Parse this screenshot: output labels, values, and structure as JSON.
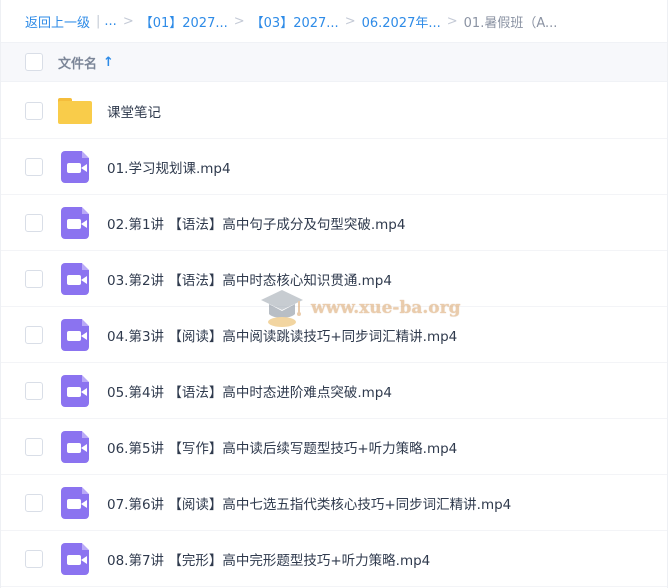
{
  "breadcrumb": {
    "back": "返回上一级",
    "separator": "|",
    "ellipsis": "...",
    "arrow": ">",
    "items": [
      "【01】2027...",
      "【03】2027...",
      "06.2027年..."
    ],
    "current": "01.暑假班（A..."
  },
  "header": {
    "column_name": "文件名",
    "sort_icon": "↑"
  },
  "files": [
    {
      "name": "课堂笔记",
      "icon": "folder-icon"
    },
    {
      "name": "01.学习规划课.mp4",
      "icon": "video-icon"
    },
    {
      "name": "02.第1讲 【语法】高中句子成分及句型突破.mp4",
      "icon": "video-icon"
    },
    {
      "name": "03.第2讲 【语法】高中时态核心知识贯通.mp4",
      "icon": "video-icon"
    },
    {
      "name": "04.第3讲 【阅读】高中阅读跳读技巧+同步词汇精讲.mp4",
      "icon": "video-icon"
    },
    {
      "name": "05.第4讲 【语法】高中时态进阶难点突破.mp4",
      "icon": "video-icon"
    },
    {
      "name": "06.第5讲 【写作】高中读后续写题型技巧+听力策略.mp4",
      "icon": "video-icon"
    },
    {
      "name": "07.第6讲 【阅读】高中七选五指代类核心技巧+同步词汇精讲.mp4",
      "icon": "video-icon"
    },
    {
      "name": "08.第7讲 【完形】高中完形题型技巧+听力策略.mp4",
      "icon": "video-icon"
    }
  ],
  "watermark": {
    "text": "www.xue-ba.org"
  },
  "colors": {
    "accent": "#2e8be7",
    "video_icon": "#8b73f0",
    "folder_icon": "#f9cc4a"
  }
}
